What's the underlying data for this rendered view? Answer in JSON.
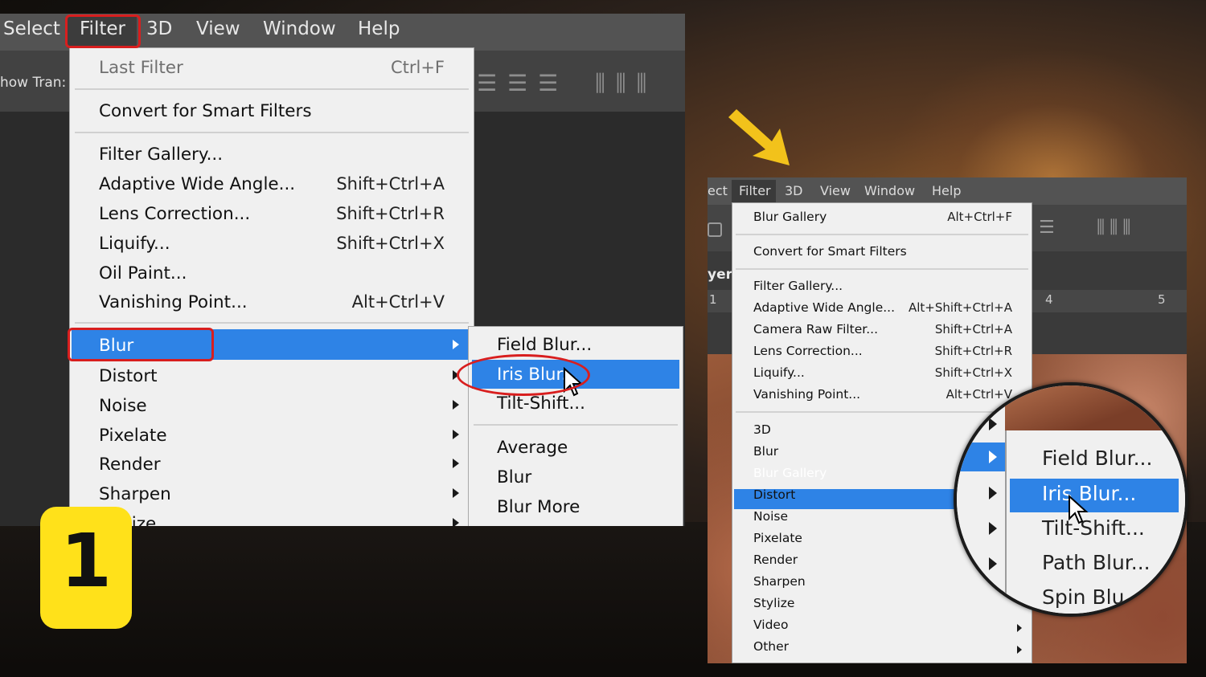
{
  "step_badge": "1",
  "left": {
    "menubar": [
      "Select",
      "Filter",
      "3D",
      "View",
      "Window",
      "Help"
    ],
    "options_text": "how Tran:",
    "filter_menu": {
      "last_filter": {
        "label": "Last Filter",
        "shortcut": "Ctrl+F"
      },
      "convert": "Convert for Smart Filters",
      "items": [
        {
          "label": "Filter Gallery...",
          "shortcut": ""
        },
        {
          "label": "Adaptive Wide Angle...",
          "shortcut": "Shift+Ctrl+A"
        },
        {
          "label": "Lens Correction...",
          "shortcut": "Shift+Ctrl+R"
        },
        {
          "label": "Liquify...",
          "shortcut": "Shift+Ctrl+X"
        },
        {
          "label": "Oil Paint...",
          "shortcut": ""
        },
        {
          "label": "Vanishing Point...",
          "shortcut": "Alt+Ctrl+V"
        }
      ],
      "submenus": [
        "Blur",
        "Distort",
        "Noise",
        "Pixelate",
        "Render",
        "Sharpen",
        "Stylize"
      ],
      "highlighted": "Blur"
    },
    "blur_submenu": {
      "gallery": [
        "Field Blur...",
        "Iris Blur...",
        "Tilt-Shift..."
      ],
      "others": [
        "Average",
        "Blur",
        "Blur More"
      ],
      "highlighted": "Iris Blur..."
    }
  },
  "right": {
    "menubar": [
      "ect",
      "Filter",
      "3D",
      "View",
      "Window",
      "Help"
    ],
    "side_text": "yer",
    "ruler": [
      "1",
      "4",
      "5"
    ],
    "filter_menu": {
      "last_filter": {
        "label": "Blur Gallery",
        "shortcut": "Alt+Ctrl+F"
      },
      "convert": "Convert for Smart Filters",
      "items": [
        {
          "label": "Filter Gallery...",
          "shortcut": ""
        },
        {
          "label": "Adaptive Wide Angle...",
          "shortcut": "Alt+Shift+Ctrl+A"
        },
        {
          "label": "Camera Raw Filter...",
          "shortcut": "Shift+Ctrl+A"
        },
        {
          "label": "Lens Correction...",
          "shortcut": "Shift+Ctrl+R"
        },
        {
          "label": "Liquify...",
          "shortcut": "Shift+Ctrl+X"
        },
        {
          "label": "Vanishing Point...",
          "shortcut": "Alt+Ctrl+V"
        }
      ],
      "submenus": [
        "3D",
        "Blur",
        "Blur Gallery",
        "Distort",
        "Noise",
        "Pixelate",
        "Render",
        "Sharpen",
        "Stylize",
        "Video",
        "Other"
      ],
      "highlighted": "Blur Gallery"
    },
    "magnified_submenu": {
      "items": [
        "Field Blur...",
        "Iris Blur...",
        "Tilt-Shift...",
        "Path Blur...",
        "Spin Blu"
      ],
      "highlighted": "Iris Blur..."
    }
  },
  "colors": {
    "highlight": "#2e83e6",
    "annotation_red": "#d81e1e",
    "badge_yellow": "#ffe11a",
    "arrow_yellow": "#f2c21b"
  }
}
